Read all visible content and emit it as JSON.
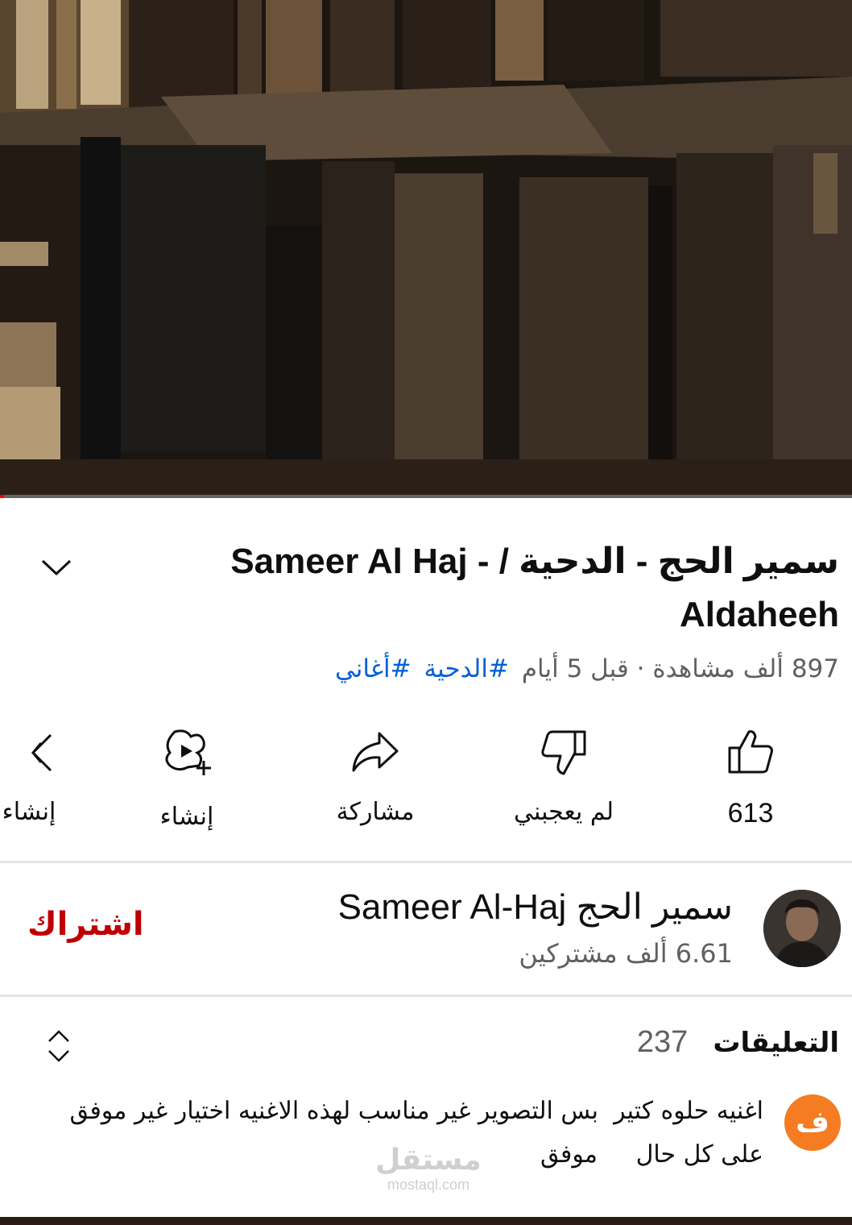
{
  "video": {
    "progress_percent": 0.5,
    "progress_color": "#ff0000"
  },
  "title": {
    "line1": "سمير الحج - الدحية / - Sameer Al Haj",
    "line2": "Aldaheeh"
  },
  "meta": {
    "views": "897 ألف مشاهدة",
    "separator": "·",
    "age": "قبل 5 أيام",
    "tags": [
      "#الدحية",
      "#أغاني"
    ],
    "tag_color": "#065fd4"
  },
  "actions": {
    "like_count": "613",
    "dislike_label": "لم يعجبني",
    "share_label": "مشاركة",
    "create_label": "إنشاء",
    "remix_label": "إنشاء"
  },
  "channel": {
    "name": "سمير الحج Sameer Al-Haj",
    "subscribers": "6.61 ألف مشتركين",
    "subscribe_label": "اشتراك",
    "subscribe_color": "#c00000"
  },
  "comments": {
    "title": "التعليقات",
    "count": "237",
    "top_comment": {
      "avatar_letter": "ف",
      "avatar_color": "#f57c22",
      "line1": "اغنيه حلوه كتير  بس التصوير غير مناسب لهذه الاغنيه اختيار غير موفق",
      "line2": "على كل حال     موفق"
    }
  },
  "watermark": {
    "arabic": "مستقل",
    "latin": "mostaql.com"
  }
}
